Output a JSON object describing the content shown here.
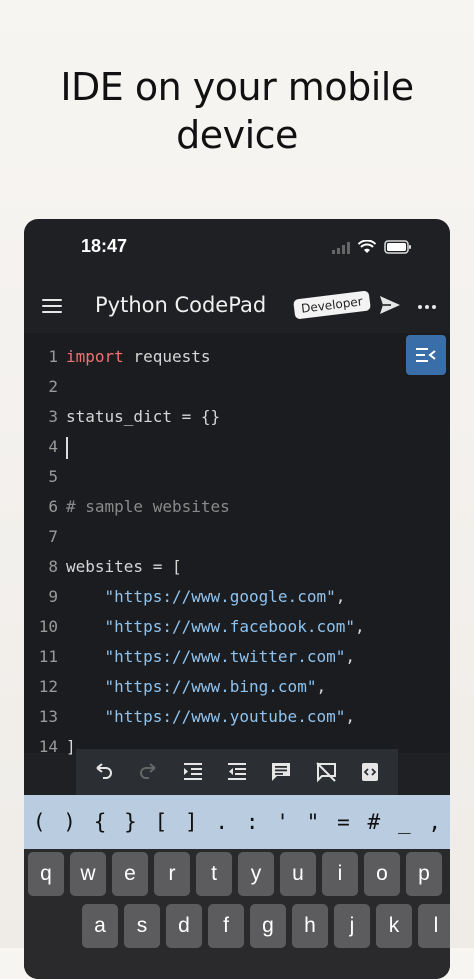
{
  "promo": {
    "title_line1": "IDE on your mobile",
    "title_line2": "device"
  },
  "status_bar": {
    "time": "18:47"
  },
  "app_bar": {
    "title": "Python CodePad",
    "badge": "Developer"
  },
  "editor": {
    "lines": [
      {
        "n": "1",
        "segments": [
          {
            "t": "import",
            "c": "kw"
          },
          {
            "t": " requests",
            "c": ""
          }
        ]
      },
      {
        "n": "2",
        "segments": []
      },
      {
        "n": "3",
        "segments": [
          {
            "t": "status_dict = {}",
            "c": ""
          }
        ]
      },
      {
        "n": "4",
        "segments": [],
        "cursor": true
      },
      {
        "n": "5",
        "segments": []
      },
      {
        "n": "6",
        "segments": [
          {
            "t": "# sample websites",
            "c": "comment"
          }
        ]
      },
      {
        "n": "7",
        "segments": []
      },
      {
        "n": "8",
        "segments": [
          {
            "t": "websites = [",
            "c": ""
          }
        ]
      },
      {
        "n": "9",
        "segments": [
          {
            "t": "    ",
            "c": ""
          },
          {
            "t": "\"https://www.google.com\"",
            "c": "str"
          },
          {
            "t": ",",
            "c": ""
          }
        ]
      },
      {
        "n": "10",
        "segments": [
          {
            "t": "    ",
            "c": ""
          },
          {
            "t": "\"https://www.facebook.com\"",
            "c": "str"
          },
          {
            "t": ",",
            "c": ""
          }
        ]
      },
      {
        "n": "11",
        "segments": [
          {
            "t": "    ",
            "c": ""
          },
          {
            "t": "\"https://www.twitter.com\"",
            "c": "str"
          },
          {
            "t": ",",
            "c": ""
          }
        ]
      },
      {
        "n": "12",
        "segments": [
          {
            "t": "    ",
            "c": ""
          },
          {
            "t": "\"https://www.bing.com\"",
            "c": "str"
          },
          {
            "t": ",",
            "c": ""
          }
        ]
      },
      {
        "n": "13",
        "segments": [
          {
            "t": "    ",
            "c": ""
          },
          {
            "t": "\"https://www.youtube.com\"",
            "c": "str"
          },
          {
            "t": ",",
            "c": ""
          }
        ]
      },
      {
        "n": "14",
        "segments": [
          {
            "t": "]",
            "c": ""
          }
        ]
      }
    ]
  },
  "toolbar": {
    "buttons": [
      "undo-icon",
      "redo-icon",
      "indent-icon",
      "outdent-icon",
      "comment-icon",
      "uncomment-icon",
      "code-snippet-icon"
    ]
  },
  "symbols": [
    "(",
    ")",
    "{",
    "}",
    "[",
    "]",
    ".",
    ":",
    "'",
    "\"",
    "=",
    "#",
    "_",
    ","
  ],
  "keyboard": {
    "row1": [
      "q",
      "w",
      "e",
      "r",
      "t",
      "y",
      "u",
      "i",
      "o",
      "p"
    ],
    "row2": [
      "a",
      "s",
      "d",
      "f",
      "g",
      "h",
      "j",
      "k",
      "l"
    ]
  },
  "colors": {
    "accent": "#3a6ea8",
    "keyword": "#ef7272",
    "string": "#8fc3ef",
    "comment": "#8a8a8a",
    "symbol_bar": "#b9cce0"
  }
}
